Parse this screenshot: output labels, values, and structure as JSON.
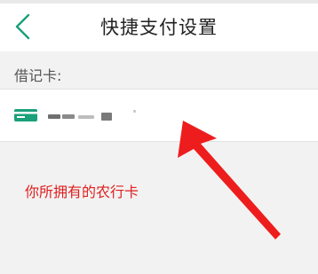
{
  "header": {
    "title": "快捷支付设置",
    "back_icon": "chevron-left-icon"
  },
  "section": {
    "label": "借记卡:"
  },
  "card": {
    "bank_icon": "bank-card-icon",
    "number_display": "redacted"
  },
  "annotation": {
    "text": "你所拥有的农行卡",
    "arrow_icon": "red-arrow-icon"
  },
  "colors": {
    "accent": "#1aa07a",
    "annotation": "#e02020",
    "background": "#f2f2f2"
  }
}
